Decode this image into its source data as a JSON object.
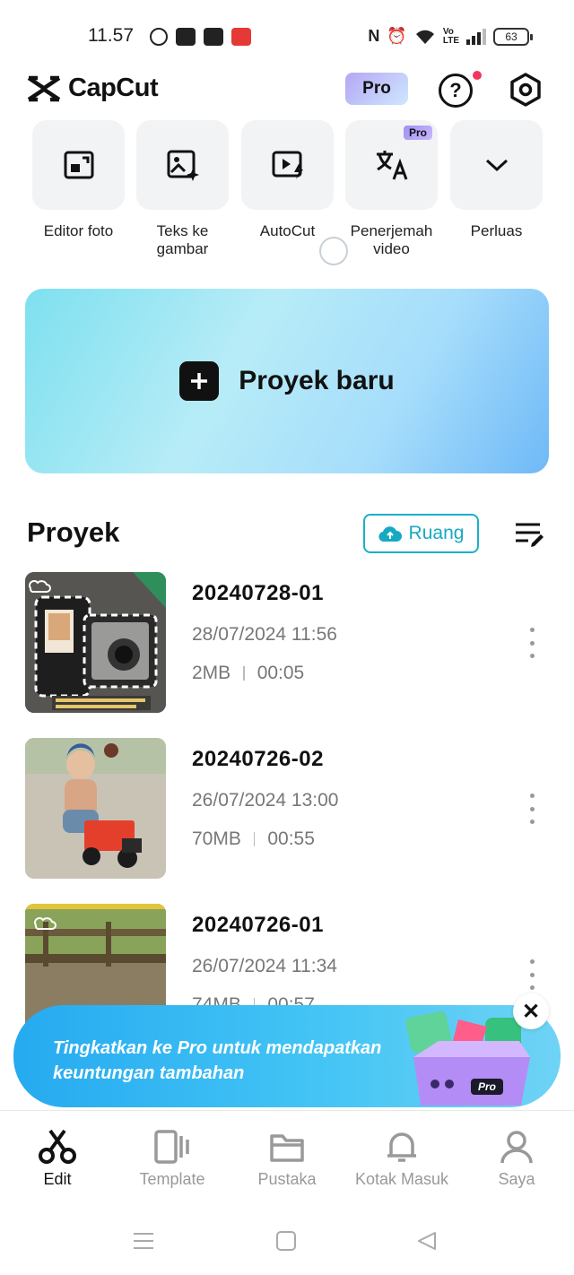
{
  "status_bar": {
    "time": "11.57",
    "battery": "63"
  },
  "header": {
    "app_name": "CapCut",
    "pro_label": "Pro"
  },
  "tools": [
    {
      "label": "Editor foto"
    },
    {
      "label": "Teks ke\ngambar"
    },
    {
      "label": "AutoCut"
    },
    {
      "label": "Penerjemah\nvideo",
      "badge": "Pro"
    },
    {
      "label": "Perluas"
    }
  ],
  "new_project": {
    "label": "Proyek baru"
  },
  "projects_section": {
    "title": "Proyek",
    "cloud_label": "Ruang"
  },
  "projects": [
    {
      "name": "20240728-01",
      "date": "28/07/2024 11:56",
      "size": "2MB",
      "duration": "00:05"
    },
    {
      "name": "20240726-02",
      "date": "26/07/2024 13:00",
      "size": "70MB",
      "duration": "00:55"
    },
    {
      "name": "20240726-01",
      "date": "26/07/2024 11:34",
      "size": "74MB",
      "duration": "00:57"
    }
  ],
  "promo": {
    "line1": "Tingkatkan ke Pro untuk mendapatkan",
    "line2": "keuntungan tambahan",
    "badge": "Pro"
  },
  "bottom_nav": [
    {
      "label": "Edit",
      "active": true
    },
    {
      "label": "Template"
    },
    {
      "label": "Pustaka"
    },
    {
      "label": "Kotak Masuk"
    },
    {
      "label": "Saya"
    }
  ],
  "colors": {
    "accent": "#17a9c2",
    "notification": "#f0385a",
    "promo_bg": "#26aaf0"
  }
}
